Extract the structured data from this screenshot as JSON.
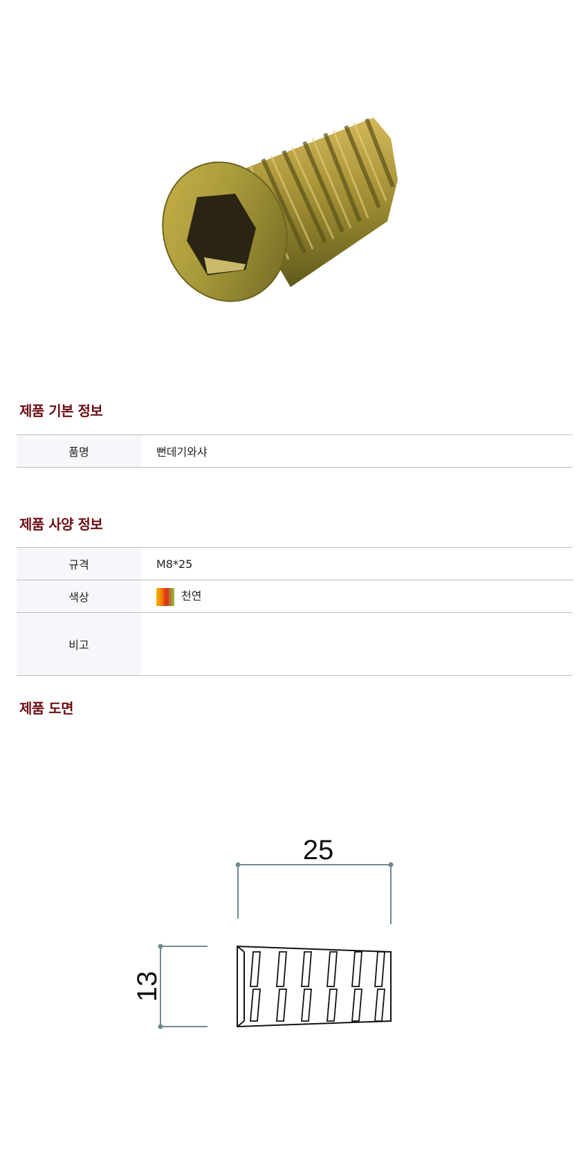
{
  "sections": {
    "basic_title": "제품 기본 정보",
    "spec_title": "제품 사양 정보",
    "drawing_title": "제품 도면"
  },
  "basic_info": {
    "name_label": "품명",
    "name_value": "뻔데기와샤"
  },
  "spec_info": {
    "size_label": "규격",
    "size_value": "M8*25",
    "color_label": "색상",
    "color_value": "천연",
    "note_label": "비고",
    "note_value": ""
  },
  "drawing": {
    "length_dim": "25",
    "diameter_dim": "13"
  },
  "colors": {
    "section_title": "#6b0f14",
    "label_bg": "#f7f7fb",
    "swatch": [
      "#f4b400",
      "#f07d00",
      "#e02a1a",
      "#8cc63f"
    ]
  }
}
